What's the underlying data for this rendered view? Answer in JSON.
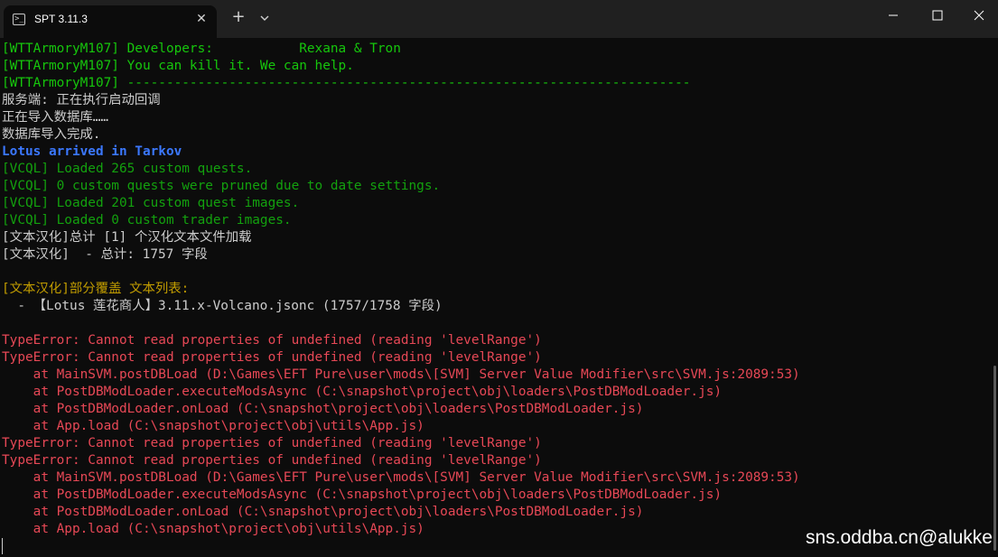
{
  "window": {
    "tab_title": "SPT 3.11.3",
    "tab_close_glyph": "✕",
    "new_tab_glyph": "+",
    "icons": [
      "terminal-icon",
      "close-icon",
      "plus-icon",
      "chevron-down-icon",
      "minimize-icon",
      "maximize-icon",
      "close-icon"
    ]
  },
  "terminal": {
    "lines": [
      {
        "text": "[WTTArmoryM107] Developers:           Rexana & Tron",
        "color": "green"
      },
      {
        "text": "[WTTArmoryM107] You can kill it. We can help.",
        "color": "green"
      },
      {
        "text": "[WTTArmoryM107] ------------------------------------------------------------------------",
        "color": "green"
      },
      {
        "text": "服务端: 正在执行启动回调",
        "color": "white"
      },
      {
        "text": "正在导入数据库……",
        "color": "white"
      },
      {
        "text": "数据库导入完成.",
        "color": "white"
      },
      {
        "text": "Lotus arrived in Tarkov",
        "color": "blue"
      },
      {
        "text": "[VCQL] Loaded 265 custom quests.",
        "color": "dgreen"
      },
      {
        "text": "[VCQL] 0 custom quests were pruned due to date settings.",
        "color": "dgreen"
      },
      {
        "text": "[VCQL] Loaded 201 custom quest images.",
        "color": "dgreen"
      },
      {
        "text": "[VCQL] Loaded 0 custom trader images.",
        "color": "dgreen"
      },
      {
        "text": "[文本汉化]总计 [1] 个汉化文本文件加载",
        "color": "white"
      },
      {
        "text": "[文本汉化]  - 总计: 1757 字段",
        "color": "white"
      },
      {
        "text": "",
        "color": "white"
      },
      {
        "text": "[文本汉化]部分覆盖 文本列表:",
        "color": "yellow"
      },
      {
        "text": "  - 【Lotus 莲花商人】3.11.x-Volcano.jsonc (1757/1758 字段)",
        "color": "white"
      },
      {
        "text": "",
        "color": "white"
      },
      {
        "text": "TypeError: Cannot read properties of undefined (reading 'levelRange')",
        "color": "red"
      },
      {
        "text": "TypeError: Cannot read properties of undefined (reading 'levelRange')",
        "color": "red"
      },
      {
        "text": "    at MainSVM.postDBLoad (D:\\Games\\EFT Pure\\user\\mods\\[SVM] Server Value Modifier\\src\\SVM.js:2089:53)",
        "color": "red"
      },
      {
        "text": "    at PostDBModLoader.executeModsAsync (C:\\snapshot\\project\\obj\\loaders\\PostDBModLoader.js)",
        "color": "red"
      },
      {
        "text": "    at PostDBModLoader.onLoad (C:\\snapshot\\project\\obj\\loaders\\PostDBModLoader.js)",
        "color": "red"
      },
      {
        "text": "    at App.load (C:\\snapshot\\project\\obj\\utils\\App.js)",
        "color": "red"
      },
      {
        "text": "TypeError: Cannot read properties of undefined (reading 'levelRange')",
        "color": "red"
      },
      {
        "text": "TypeError: Cannot read properties of undefined (reading 'levelRange')",
        "color": "red"
      },
      {
        "text": "    at MainSVM.postDBLoad (D:\\Games\\EFT Pure\\user\\mods\\[SVM] Server Value Modifier\\src\\SVM.js:2089:53)",
        "color": "red"
      },
      {
        "text": "    at PostDBModLoader.executeModsAsync (C:\\snapshot\\project\\obj\\loaders\\PostDBModLoader.js)",
        "color": "red"
      },
      {
        "text": "    at PostDBModLoader.onLoad (C:\\snapshot\\project\\obj\\loaders\\PostDBModLoader.js)",
        "color": "red"
      },
      {
        "text": "    at App.load (C:\\snapshot\\project\\obj\\utils\\App.js)",
        "color": "red"
      }
    ]
  },
  "watermark": "sns.oddba.cn@alukke"
}
